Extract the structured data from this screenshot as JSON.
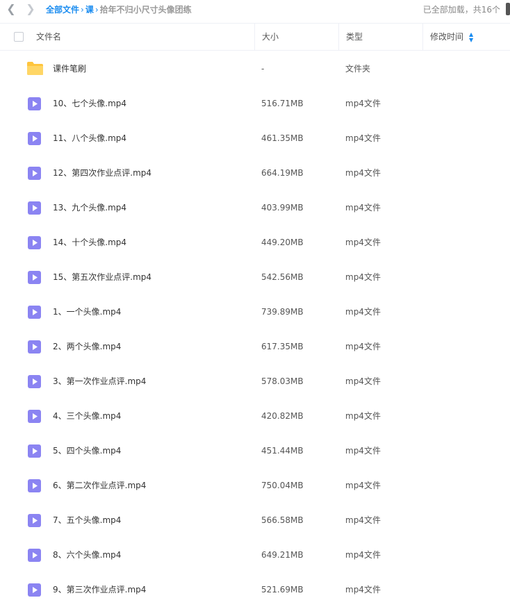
{
  "nav": {
    "back_icon": "chevron-left-icon",
    "forward_icon": "chevron-right-icon"
  },
  "breadcrumb": {
    "root": "全部文件",
    "sep1": "›",
    "level1": "课",
    "sep2": "›",
    "current": "拾年不归小尺寸头像团练"
  },
  "status": "已全部加载，共16个",
  "columns": {
    "name": "文件名",
    "size": "大小",
    "type": "类型",
    "time": "修改时间"
  },
  "sort_icon": "▲▼",
  "files": [
    {
      "name": "课件笔刷",
      "size": "-",
      "type": "文件夹",
      "time": "",
      "icon": "folder-icon"
    },
    {
      "name": "10、七个头像.mp4",
      "size": "516.71MB",
      "type": "mp4文件",
      "time": "",
      "icon": "video-icon"
    },
    {
      "name": "11、八个头像.mp4",
      "size": "461.35MB",
      "type": "mp4文件",
      "time": "",
      "icon": "video-icon"
    },
    {
      "name": "12、第四次作业点评.mp4",
      "size": "664.19MB",
      "type": "mp4文件",
      "time": "",
      "icon": "video-icon"
    },
    {
      "name": "13、九个头像.mp4",
      "size": "403.99MB",
      "type": "mp4文件",
      "time": "",
      "icon": "video-icon"
    },
    {
      "name": "14、十个头像.mp4",
      "size": "449.20MB",
      "type": "mp4文件",
      "time": "",
      "icon": "video-icon"
    },
    {
      "name": "15、第五次作业点评.mp4",
      "size": "542.56MB",
      "type": "mp4文件",
      "time": "",
      "icon": "video-icon"
    },
    {
      "name": "1、一个头像.mp4",
      "size": "739.89MB",
      "type": "mp4文件",
      "time": "",
      "icon": "video-icon"
    },
    {
      "name": "2、两个头像.mp4",
      "size": "617.35MB",
      "type": "mp4文件",
      "time": "",
      "icon": "video-icon"
    },
    {
      "name": "3、第一次作业点评.mp4",
      "size": "578.03MB",
      "type": "mp4文件",
      "time": "",
      "icon": "video-icon"
    },
    {
      "name": "4、三个头像.mp4",
      "size": "420.82MB",
      "type": "mp4文件",
      "time": "",
      "icon": "video-icon"
    },
    {
      "name": "5、四个头像.mp4",
      "size": "451.44MB",
      "type": "mp4文件",
      "time": "",
      "icon": "video-icon"
    },
    {
      "name": "6、第二次作业点评.mp4",
      "size": "750.04MB",
      "type": "mp4文件",
      "time": "",
      "icon": "video-icon"
    },
    {
      "name": "7、五个头像.mp4",
      "size": "566.58MB",
      "type": "mp4文件",
      "time": "",
      "icon": "video-icon"
    },
    {
      "name": "8、六个头像.mp4",
      "size": "649.21MB",
      "type": "mp4文件",
      "time": "",
      "icon": "video-icon"
    },
    {
      "name": "9、第三次作业点评.mp4",
      "size": "521.69MB",
      "type": "mp4文件",
      "time": "",
      "icon": "video-icon"
    }
  ],
  "colors": {
    "accent": "#1a8cf0",
    "video_icon": "#8b84f2",
    "folder_icon": "#ffc53d"
  }
}
